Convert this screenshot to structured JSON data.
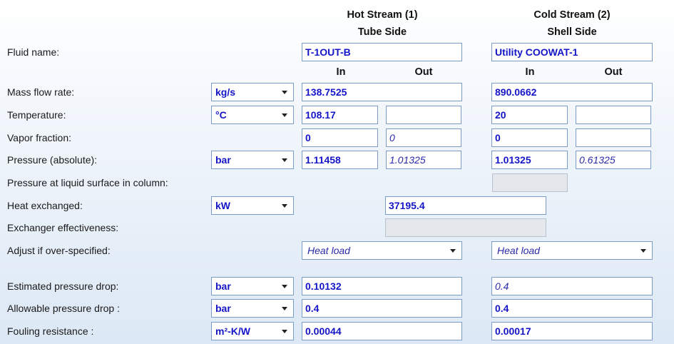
{
  "header": {
    "hot_title": "Hot Stream (1)",
    "hot_sub": "Tube Side",
    "cold_title": "Cold Stream (2)",
    "cold_sub": "Shell Side",
    "in_label": "In",
    "out_label": "Out"
  },
  "rows": {
    "fluid_name": {
      "label": "Fluid name:",
      "hot": "T-1OUT-B",
      "cold": "Utility COOWAT-1"
    },
    "mass_flow": {
      "label": "Mass flow rate:",
      "unit": "kg/s",
      "hot": "138.7525",
      "cold": "890.0662"
    },
    "temperature": {
      "label": "Temperature:",
      "unit": "°C",
      "hot_in": "108.17",
      "hot_out": "",
      "cold_in": "20",
      "cold_out": ""
    },
    "vapor_fraction": {
      "label": "Vapor fraction:",
      "hot_in": "0",
      "hot_out": "0",
      "cold_in": "0",
      "cold_out": ""
    },
    "pressure": {
      "label": "Pressure (absolute):",
      "unit": "bar",
      "hot_in": "1.11458",
      "hot_out": "1.01325",
      "cold_in": "1.01325",
      "cold_out": "0.61325"
    },
    "liquid_surface": {
      "label": "Pressure at liquid surface in column:"
    },
    "heat_exchanged": {
      "label": "Heat exchanged:",
      "unit": "kW",
      "value": "37195.4"
    },
    "effectiveness": {
      "label": "Exchanger effectiveness:"
    },
    "adjust": {
      "label": "Adjust if over-specified:",
      "hot": "Heat load",
      "cold": "Heat load"
    },
    "est_dp": {
      "label": "Estimated pressure drop:",
      "unit": "bar",
      "hot": "0.10132",
      "cold": "0.4"
    },
    "allow_dp": {
      "label": "Allowable pressure drop :",
      "unit": "bar",
      "hot": "0.4",
      "cold": "0.4"
    },
    "fouling": {
      "label": "Fouling resistance :",
      "unit": "m²-K/W",
      "hot": "0.00044",
      "cold": "0.00017"
    }
  }
}
